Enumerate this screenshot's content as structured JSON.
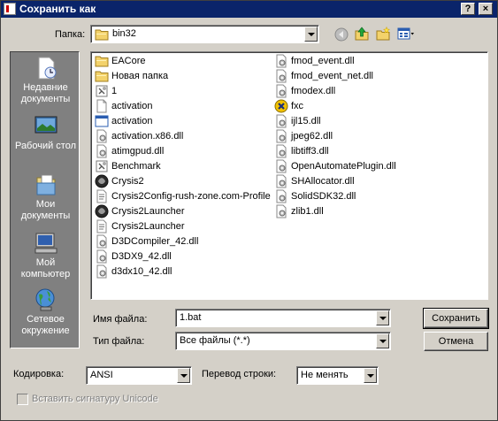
{
  "dialog": {
    "title": "Сохранить как",
    "help_label": "?",
    "close_label": "×"
  },
  "location": {
    "label": "Папка:",
    "value": "bin32"
  },
  "places": [
    {
      "label": "Недавние документы",
      "icon": "recent-documents-icon"
    },
    {
      "label": "Рабочий стол",
      "icon": "desktop-icon"
    },
    {
      "label": "Мои документы",
      "icon": "my-documents-icon"
    },
    {
      "label": "Мой компьютер",
      "icon": "my-computer-icon"
    },
    {
      "label": "Сетевое окружение",
      "icon": "network-places-icon"
    }
  ],
  "files": [
    {
      "name": "EACore",
      "icon": "folder-icon"
    },
    {
      "name": "Новая папка",
      "icon": "folder-icon"
    },
    {
      "name": "1",
      "icon": "batch-file-icon"
    },
    {
      "name": "activation",
      "icon": "generic-file-icon"
    },
    {
      "name": "activation",
      "icon": "executable-icon"
    },
    {
      "name": "activation.x86.dll",
      "icon": "dll-icon"
    },
    {
      "name": "atimgpud.dll",
      "icon": "dll-icon"
    },
    {
      "name": "Benchmark",
      "icon": "batch-file-icon"
    },
    {
      "name": "Crysis2",
      "icon": "crysis-app-icon"
    },
    {
      "name": "Crysis2Config-rush-zone.com-Profile",
      "icon": "text-file-icon"
    },
    {
      "name": "Crysis2Launcher",
      "icon": "crysis-app-icon"
    },
    {
      "name": "Crysis2Launcher",
      "icon": "text-file-icon"
    },
    {
      "name": "D3DCompiler_42.dll",
      "icon": "dll-icon"
    },
    {
      "name": "D3DX9_42.dll",
      "icon": "dll-icon"
    },
    {
      "name": "d3dx10_42.dll",
      "icon": "dll-icon"
    },
    {
      "name": "fmod_event.dll",
      "icon": "dll-icon"
    },
    {
      "name": "fmod_event_net.dll",
      "icon": "dll-icon"
    },
    {
      "name": "fmodex.dll",
      "icon": "dll-icon"
    },
    {
      "name": "fxc",
      "icon": "fxc-app-icon"
    },
    {
      "name": "ijl15.dll",
      "icon": "dll-icon"
    },
    {
      "name": "jpeg62.dll",
      "icon": "dll-icon"
    },
    {
      "name": "libtiff3.dll",
      "icon": "dll-icon"
    },
    {
      "name": "OpenAutomatePlugin.dll",
      "icon": "dll-icon"
    },
    {
      "name": "SHAllocator.dll",
      "icon": "dll-icon"
    },
    {
      "name": "SolidSDK32.dll",
      "icon": "dll-icon"
    },
    {
      "name": "zlib1.dll",
      "icon": "dll-icon"
    }
  ],
  "filename": {
    "label": "Имя файла:",
    "value": "1.bat"
  },
  "filetype": {
    "label": "Тип файла:",
    "value": "Все файлы  (*.*)"
  },
  "encoding": {
    "label": "Кодировка:",
    "value": "ANSI"
  },
  "line_ending": {
    "label": "Перевод строки:",
    "value": "Не менять"
  },
  "buttons": {
    "save": "Сохранить",
    "cancel": "Отмена"
  },
  "bom_checkbox": {
    "label": "Вставить сигнатуру Unicode",
    "checked": false
  }
}
